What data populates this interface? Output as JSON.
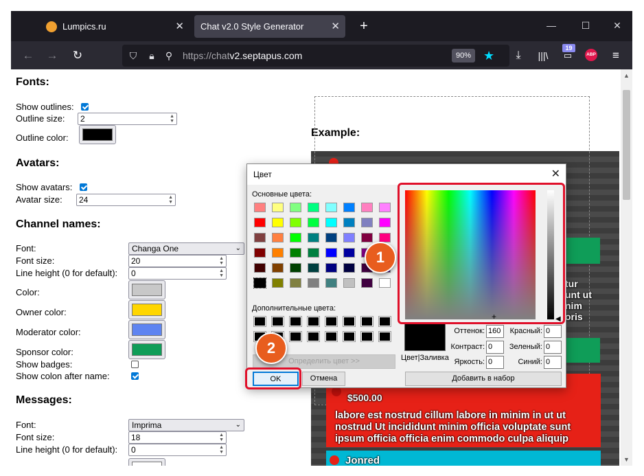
{
  "browser": {
    "tabs": [
      {
        "title": "Lumpics.ru",
        "close": "✕"
      },
      {
        "title": "Chat v2.0 Style Generator",
        "close": "✕"
      }
    ],
    "new_tab": "+",
    "window_controls": {
      "minimize": "—",
      "maximize": "☐",
      "close": "✕"
    },
    "nav": {
      "back": "←",
      "forward": "→",
      "reload": "↻"
    },
    "url": {
      "prefix": "https://chat",
      "domain": "v2.septapus.com"
    },
    "zoom": "90%",
    "toolbar_badge": "19",
    "abp_label": "ABP"
  },
  "settings": {
    "fonts": {
      "heading": "Fonts:",
      "show_outlines_label": "Show outlines:",
      "outline_size_label": "Outline size:",
      "outline_size_value": "2",
      "outline_color_label": "Outline color:"
    },
    "avatars": {
      "heading": "Avatars:",
      "show_avatars_label": "Show avatars:",
      "avatar_size_label": "Avatar size:",
      "avatar_size_value": "24"
    },
    "channel_names": {
      "heading": "Channel names:",
      "font_label": "Font:",
      "font_value": "Changa One",
      "font_size_label": "Font size:",
      "font_size_value": "20",
      "line_height_label": "Line height (0 for default):",
      "line_height_value": "0",
      "color_label": "Color:",
      "owner_color_label": "Owner color:",
      "moderator_color_label": "Moderator color:",
      "sponsor_color_label": "Sponsor color:",
      "show_badges_label": "Show badges:",
      "show_colon_label": "Show colon after name:"
    },
    "messages": {
      "heading": "Messages:",
      "font_label": "Font:",
      "font_value": "Imprima",
      "font_size_label": "Font size:",
      "font_size_value": "18",
      "line_height_label": "Line height (0 for default):",
      "line_height_value": "0"
    }
  },
  "colors": {
    "outline": "#000000",
    "name": "#c8c8c8",
    "owner": "#ffd600",
    "moderator": "#5e84f1",
    "sponsor": "#0f9d58",
    "green_block": "#0f9d58",
    "red_block": "#e62117",
    "cyan_block": "#00b8d4",
    "accent": "#e0102a",
    "step_badge": "#e85d1e"
  },
  "example": {
    "heading": "Example:",
    "fragments_right": [
      "oris",
      "tur",
      "unt ut",
      "nim",
      "oris"
    ],
    "donation_amount": "$500.00",
    "donation_text": "labore est nostrud cillum labore in minim in ut ut nostrud Ut incididunt minim officia voluptate sunt ipsum officia officia enim commodo culpa aliquip",
    "last_name": "Jonred"
  },
  "color_dialog": {
    "title": "Цвет",
    "close": "✕",
    "basic_colors_label": "Основные цвета:",
    "custom_colors_label": "Дополнительные цвета:",
    "define_button": "Определить цвет >>",
    "ok_button": "OK",
    "cancel_button": "Отмена",
    "add_button": "Добавить в набор",
    "preview_label": "Цвет|Заливка",
    "fields": {
      "hue_label": "Оттенок:",
      "hue_value": "160",
      "sat_label": "Контраст:",
      "sat_value": "0",
      "lum_label": "Яркость:",
      "lum_value": "0",
      "red_label": "Красный:",
      "red_value": "0",
      "green_label": "Зеленый:",
      "green_value": "0",
      "blue_label": "Синий:",
      "blue_value": "0"
    },
    "basic_colors": [
      "#ff8080",
      "#ffff80",
      "#80ff80",
      "#00ff80",
      "#80ffff",
      "#0080ff",
      "#ff80c0",
      "#ff80ff",
      "#ff0000",
      "#ffff00",
      "#80ff00",
      "#00ff40",
      "#00ffff",
      "#0080c0",
      "#8080c0",
      "#ff00ff",
      "#804040",
      "#ff8040",
      "#00ff00",
      "#008080",
      "#004080",
      "#8080ff",
      "#800040",
      "#ff0080",
      "#800000",
      "#ff8000",
      "#008000",
      "#008040",
      "#0000ff",
      "#0000a0",
      "#800080",
      "#8000ff",
      "#400000",
      "#804000",
      "#004000",
      "#004040",
      "#000080",
      "#000040",
      "#400040",
      "#400080",
      "#000000",
      "#808000",
      "#808040",
      "#808080",
      "#408080",
      "#c0c0c0",
      "#400040",
      "#ffffff"
    ]
  },
  "annotations": {
    "step1": "1",
    "step2": "2"
  }
}
